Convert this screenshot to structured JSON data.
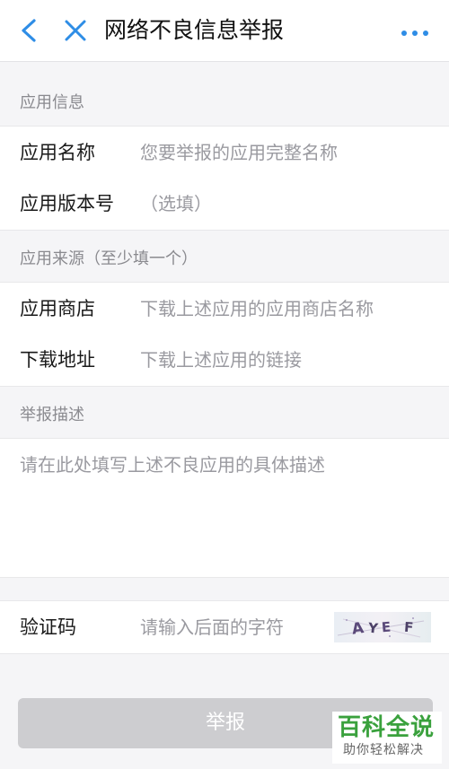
{
  "header": {
    "title": "网络不良信息举报",
    "back_icon": "chevron-left-icon",
    "close_icon": "close-icon",
    "more_icon": "more-dots-icon",
    "accent_color": "#2e8de6"
  },
  "app_info": {
    "section_label": "应用信息",
    "name_label": "应用名称",
    "name_placeholder": "您要举报的应用完整名称",
    "version_label": "应用版本号",
    "version_placeholder": "（选填）"
  },
  "app_source": {
    "section_label": "应用来源（至少填一个）",
    "store_label": "应用商店",
    "store_placeholder": "下载上述应用的应用商店名称",
    "url_label": "下载地址",
    "url_placeholder": "下载上述应用的链接"
  },
  "description": {
    "section_label": "举报描述",
    "placeholder": "请在此处填写上述不良应用的具体描述"
  },
  "captcha": {
    "label": "验证码",
    "placeholder": "请输入后面的字符",
    "image_text": "AYE F"
  },
  "submit": {
    "label": "举报",
    "disabled": true
  },
  "watermark": {
    "main": "百科全说",
    "sub": "助你轻松解决"
  }
}
